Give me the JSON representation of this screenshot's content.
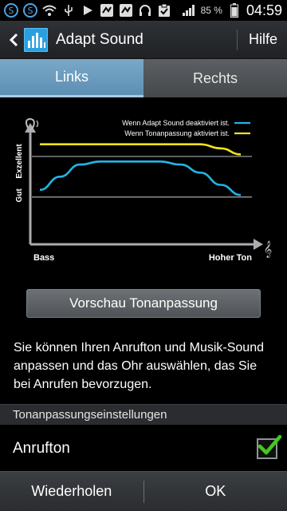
{
  "status_bar": {
    "battery_percent": "85 %",
    "time": "04:59",
    "icons": [
      "s-icon",
      "s-icon",
      "wifi-icon",
      "usb-icon",
      "play-icon",
      "app-icon",
      "app-icon",
      "headphones-icon",
      "clipboard-icon",
      "signal-icon",
      "battery-icon"
    ]
  },
  "action_bar": {
    "title": "Adapt Sound",
    "help": "Hilfe"
  },
  "tabs": [
    {
      "label": "Links",
      "active": true
    },
    {
      "label": "Rechts",
      "active": false
    }
  ],
  "chart_data": {
    "type": "line",
    "x": [
      0,
      10,
      20,
      30,
      40,
      50,
      60,
      70,
      80,
      90,
      100
    ],
    "xlabel_left": "Bass",
    "xlabel_right": "Hoher Ton",
    "y_labels": [
      "Exzellent",
      "Gut"
    ],
    "legend": [
      {
        "name": "Wenn Adapt Sound deaktiviert ist.",
        "color": "#22b4e6"
      },
      {
        "name": "Wenn Tonanpassung aktiviert ist.",
        "color": "#f2e21c"
      }
    ],
    "series": [
      {
        "name": "Wenn Adapt Sound deaktiviert ist.",
        "color": "#22b4e6",
        "values": [
          45,
          58,
          70,
          73,
          73,
          73,
          73,
          70,
          62,
          50,
          40
        ]
      },
      {
        "name": "Wenn Tonanpassung aktiviert ist.",
        "color": "#f2e21c",
        "values": [
          90,
          90,
          90,
          90,
          90,
          90,
          90,
          90,
          90,
          86,
          80
        ]
      }
    ],
    "ylim": [
      0,
      100
    ],
    "gridlines": [
      78,
      38
    ]
  },
  "preview_button": "Vorschau Tonanpassung",
  "description": "Sie können Ihren Anrufton und Musik-Sound anpassen und das Ohr auswählen, das Sie bei Anrufen bevorzugen.",
  "section_header": "Tonanpassungseinstellungen",
  "setting": {
    "label": "Anrufton",
    "checked": true
  },
  "bottom_bar": {
    "retry": "Wiederholen",
    "ok": "OK"
  },
  "colors": {
    "accent": "#5d8fb3",
    "check": "#43c91c"
  }
}
